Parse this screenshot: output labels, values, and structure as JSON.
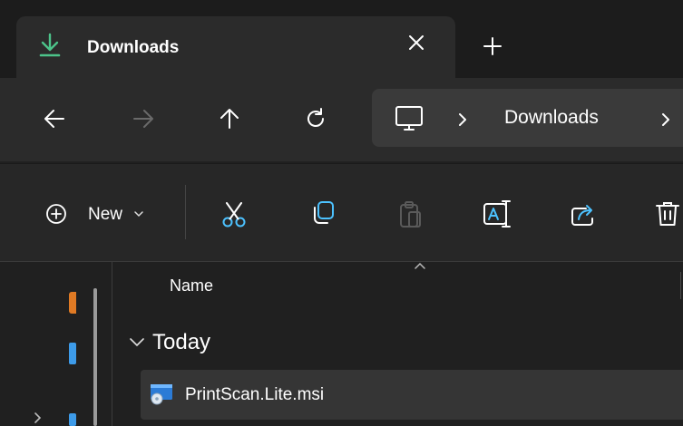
{
  "tab": {
    "title": "Downloads",
    "icon": "download-icon",
    "accent": "#4cc38a"
  },
  "nav": {
    "breadcrumb_current": "Downloads"
  },
  "toolbar": {
    "new_label": "New"
  },
  "columns": {
    "name": "Name"
  },
  "group": {
    "label": "Today"
  },
  "files": [
    {
      "name": "PrintScan.Lite.msi",
      "icon": "msi-installer-icon"
    }
  ]
}
